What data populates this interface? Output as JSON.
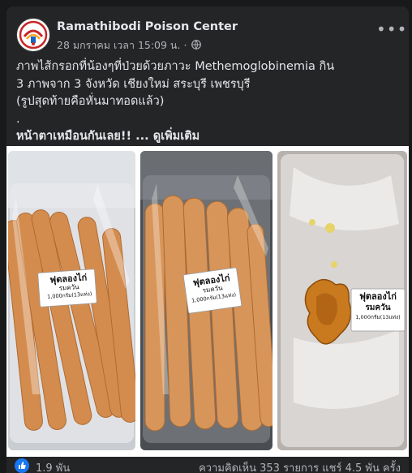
{
  "post": {
    "page_name": "Ramathibodi Poison Center",
    "timestamp": "28 มกราคม เวลา 15:09 น.",
    "separator": "·",
    "privacy_icon": "globe-icon",
    "more_label": "•••",
    "text_lines": [
      "ภาพไส้กรอกที่น้องๆที่ป่วยด้วยภาวะ Methemoglobinemia กิน",
      "3 ภาพจาก 3 จังหวัด เชียงใหม่ สระบุรี เพชรบุรี",
      "(รูปสุดท้ายคือหั่นมาทอดแล้ว)",
      "."
    ],
    "last_line_text": "หน้าตาเหมือนกันเลย!! ... ",
    "see_more": "ดูเพิ่มเติม"
  },
  "photos": [
    {
      "label_line1": "ฟุตลองไก่",
      "label_line2": "รมควัน",
      "label_line3": "1,000กรัม(13แท่ง)"
    },
    {
      "label_line1": "ฟุตลองไก่",
      "label_line2": "รมควัน",
      "label_line3": "1,000กรัม(13แท่ง)"
    },
    {
      "label_line1": "ฟุตลองไก่",
      "label_line2": "รมควัน",
      "label_line3": "1,000กรัม(13แท่ง)"
    }
  ],
  "footer": {
    "reaction_icon": "thumbs-up-icon",
    "reaction_count": "1.9 พัน",
    "stats": "ความคิดเห็น 353 รายการ  แชร์ 4.5 พัน ครั้ง"
  },
  "colors": {
    "background": "#18191a",
    "card": "#242526",
    "primary_text": "#e4e6eb",
    "secondary_text": "#b0b3b8",
    "like_blue": "#1877f2"
  }
}
